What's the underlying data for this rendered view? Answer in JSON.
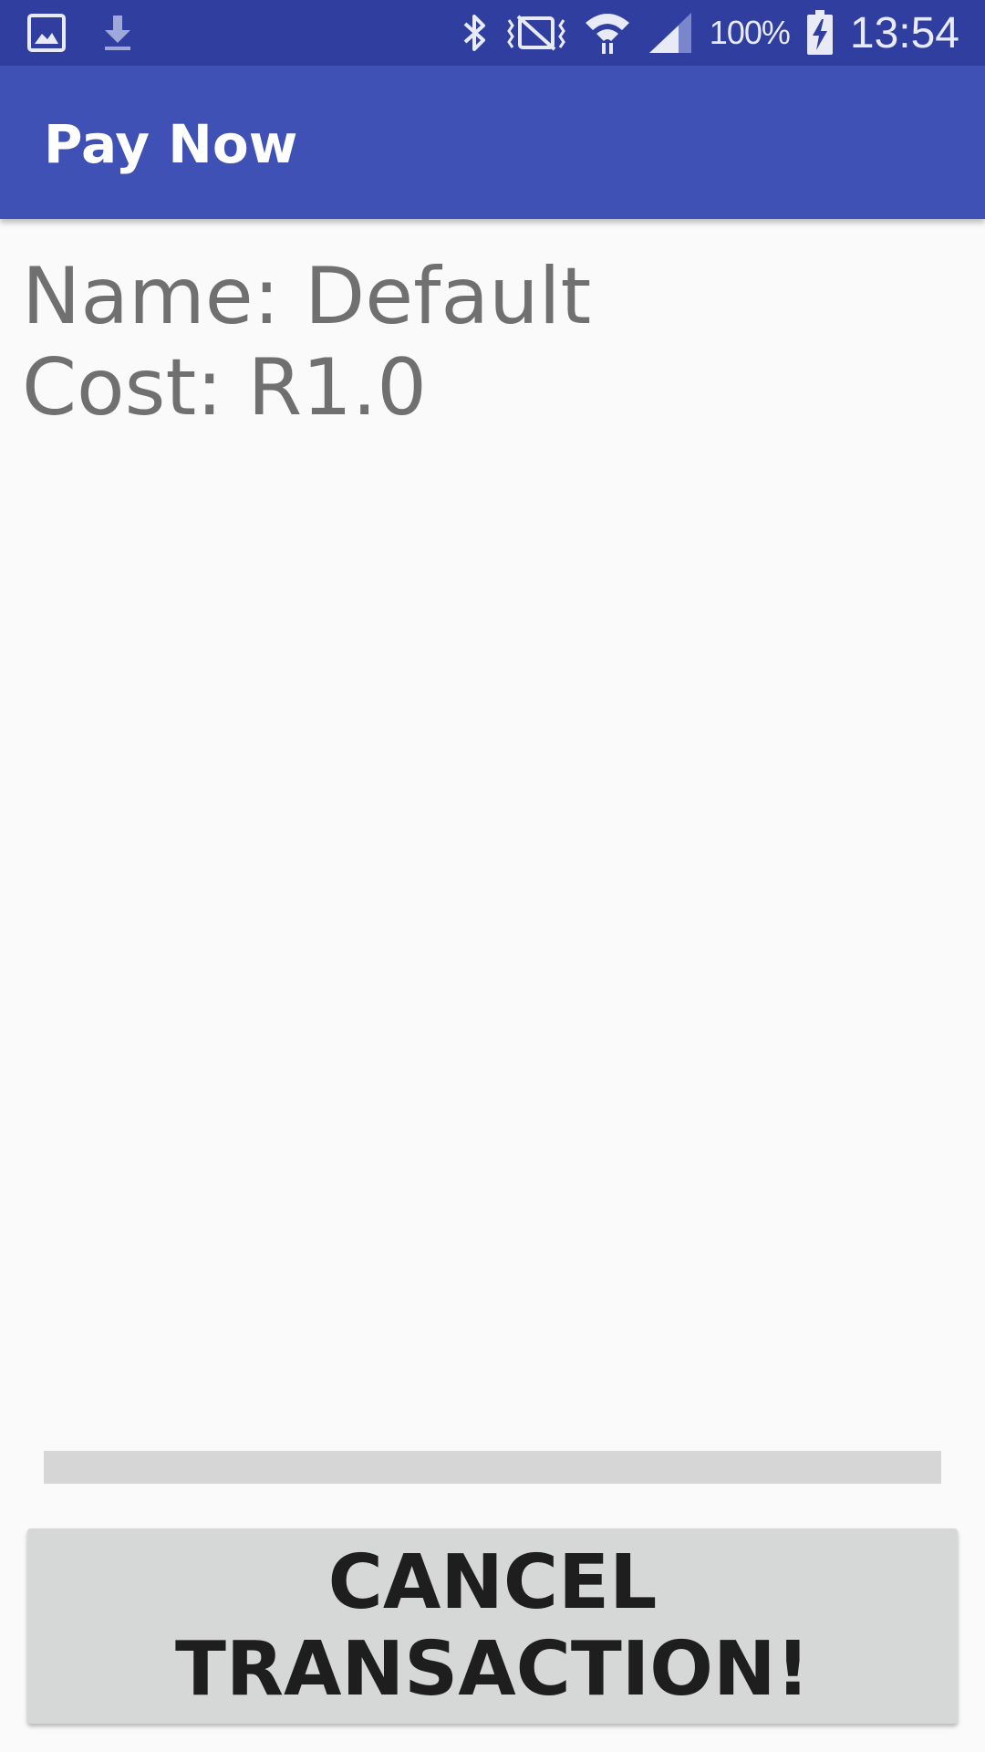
{
  "status_bar": {
    "left_icons": [
      "image-icon",
      "download-icon"
    ],
    "right_icons": [
      "bluetooth-icon",
      "vibrate-icon",
      "wifi-icon",
      "signal-icon",
      "battery-charging-icon"
    ],
    "battery_percent": "100%",
    "time": "13:54",
    "background": "#303f9f"
  },
  "app_bar": {
    "title": "Pay Now",
    "background": "#3f51b5"
  },
  "details": {
    "name_line": "Name: Default",
    "cost_line": "Cost: R1.0"
  },
  "progress": {
    "value": 0
  },
  "cancel_button": {
    "label": "CANCEL TRANSACTION!"
  }
}
